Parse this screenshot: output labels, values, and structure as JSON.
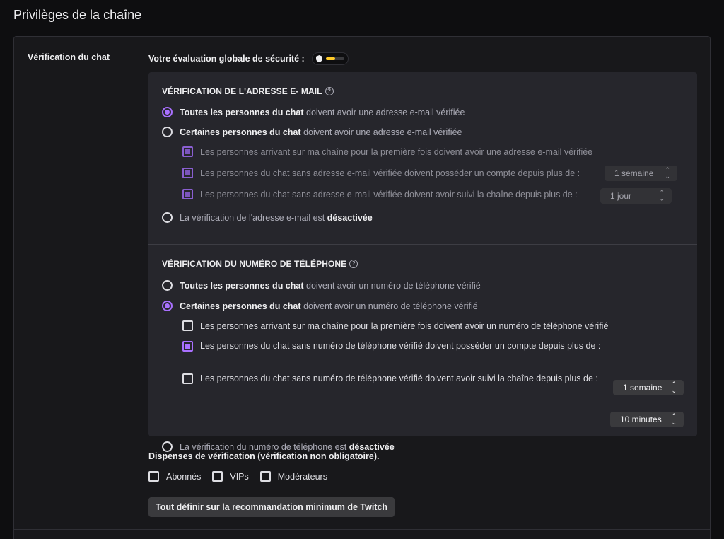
{
  "page": {
    "title": "Privilèges de la chaîne"
  },
  "chat_verification": {
    "label": "Vérification du chat",
    "security_rating_label": "Votre évaluation globale de sécurité :",
    "security_rating_level": 0.5,
    "security_rating_color": "#ffca28"
  },
  "email": {
    "heading": "VÉRIFICATION DE L'ADRESSE E- MAIL",
    "options": [
      {
        "bold": "Toutes les personnes du chat",
        "rest": "doivent avoir une adresse e-mail vérifiée",
        "selected": true
      },
      {
        "bold": "Certaines personnes du chat",
        "rest": "doivent avoir une adresse e-mail vérifiée",
        "selected": false
      }
    ],
    "sub": [
      {
        "text": "Les personnes arrivant sur ma chaîne pour la première fois doivent avoir une adresse e-mail vérifiée",
        "checked": true
      },
      {
        "text": "Les personnes du chat sans adresse e-mail vérifiée doivent posséder un compte depuis plus de :",
        "checked": true,
        "select": "1 semaine"
      },
      {
        "text": "Les personnes du chat sans adresse e-mail vérifiée doivent avoir suivi la chaîne depuis plus de :",
        "checked": true,
        "select": "1 jour"
      }
    ],
    "off_text": "La vérification de l'adresse e-mail est",
    "off_bold": "désactivée"
  },
  "phone": {
    "heading": "VÉRIFICATION DU NUMÉRO DE TÉLÉPHONE",
    "options": [
      {
        "bold": "Toutes les personnes du chat",
        "rest": "doivent avoir un numéro de téléphone vérifié",
        "selected": false
      },
      {
        "bold": "Certaines personnes du chat",
        "rest": "doivent avoir un numéro de téléphone vérifié",
        "selected": true
      }
    ],
    "sub": [
      {
        "text": "Les personnes arrivant sur ma chaîne pour la première fois doivent avoir un numéro de téléphone vérifié",
        "checked": false
      },
      {
        "text": "Les personnes du chat sans numéro de téléphone vérifié doivent posséder un compte depuis plus de :",
        "checked": true,
        "select": "1 semaine"
      },
      {
        "text": "Les personnes du chat sans numéro de téléphone vérifié doivent avoir suivi la chaîne depuis plus de :",
        "checked": false,
        "select": "10 minutes"
      }
    ],
    "off_text": "La vérification du numéro de téléphone est",
    "off_bold": "désactivée"
  },
  "exemptions": {
    "title": "Dispenses de vérification (vérification non obligatoire).",
    "items": [
      "Abonnés",
      "VIPs",
      "Modérateurs"
    ]
  },
  "recommend_button": "Tout définir sur la recommandation minimum de Twitch",
  "icons": {
    "help": "help-circle-icon",
    "shield": "shield-icon",
    "caret": "up-down-caret-icon"
  },
  "colors": {
    "accent": "#a970ff",
    "background": "#0e0e10",
    "panel": "#18181b",
    "card": "#26262c"
  }
}
